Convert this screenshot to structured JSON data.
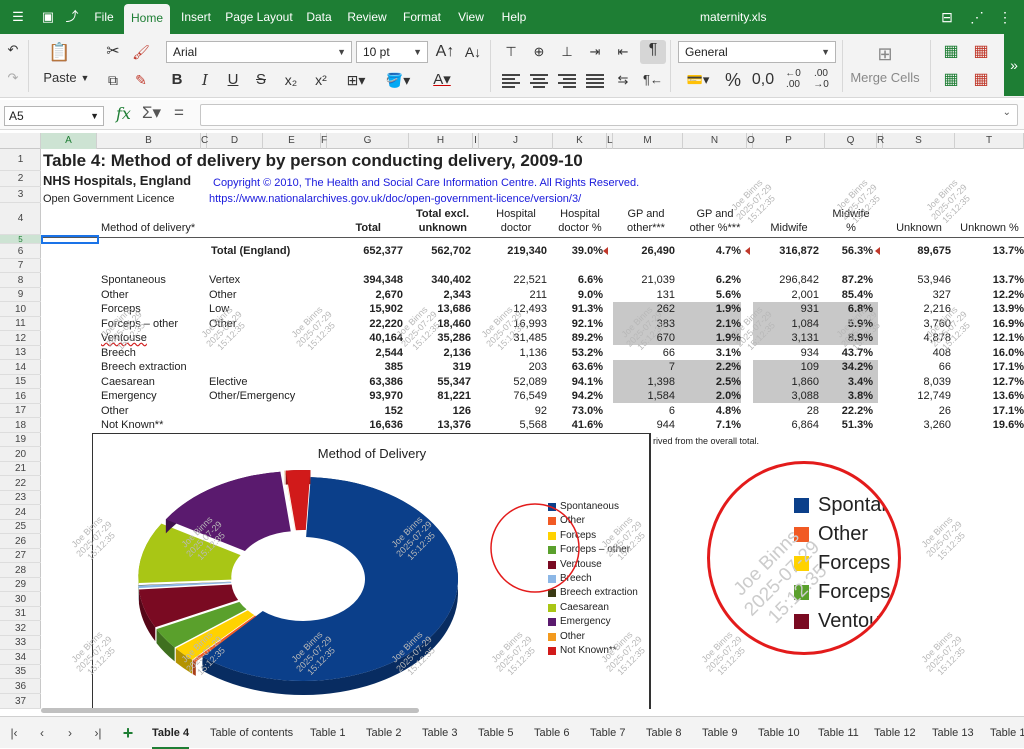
{
  "app": {
    "file_name": "maternity.xls",
    "menu_tabs": [
      "File",
      "Home",
      "Insert",
      "Page Layout",
      "Data",
      "Review",
      "Format",
      "View",
      "Help"
    ],
    "active_tab": "Home"
  },
  "ribbon": {
    "paste_label": "Paste",
    "font_name": "Arial",
    "font_size": "10 pt",
    "number_format": "General",
    "merge_cells_label": "Merge Cells"
  },
  "formula_bar": {
    "cell_ref": "A5",
    "formula": ""
  },
  "columns": [
    "A",
    "B",
    "C",
    "D",
    "E",
    "F",
    "G",
    "H",
    "I",
    "J",
    "K",
    "L",
    "M",
    "N",
    "O",
    "P",
    "Q",
    "R",
    "S",
    "T"
  ],
  "rows": [
    "1",
    "2",
    "3",
    "4",
    "5",
    "6",
    "7",
    "8",
    "9",
    "10",
    "11",
    "12",
    "13",
    "14",
    "15",
    "16",
    "17",
    "18",
    "19",
    "20",
    "21",
    "22",
    "23",
    "24",
    "25",
    "26",
    "27",
    "28",
    "29",
    "30",
    "31",
    "32",
    "33",
    "34",
    "35",
    "36",
    "37"
  ],
  "sheet": {
    "title": "Table 4: Method of delivery by person conducting delivery, 2009-10",
    "org": "NHS Hospitals, England",
    "copyright": "Copyright © 2010, The Health and Social Care Information Centre. All Rights Reserved.",
    "licence": "Open Government Licence",
    "licence_url": "https://www.nationalarchives.gov.uk/doc/open-government-licence/version/3/",
    "headers": {
      "method": "Method of delivery*",
      "total": "Total",
      "total_excl_1": "Total excl.",
      "total_excl_2": "unknown",
      "hosp_doc_1": "Hospital",
      "hosp_doc_2": "doctor",
      "hosp_pct_1": "Hospital",
      "hosp_pct_2": "doctor %",
      "gp_1": "GP and",
      "gp_2": "other***",
      "gp_pct_1": "GP and",
      "gp_pct_2": "other %***",
      "midwife": "Midwife",
      "midwife_pct_1": "Midwife",
      "midwife_pct_2": "%",
      "unknown": "Unknown",
      "unknown_pct": "Unknown %"
    },
    "total_row": {
      "label": "Total (England)",
      "total": "652,377",
      "excl": "562,702",
      "hosp": "219,340",
      "hosp_pct": "39.0%",
      "gp": "26,490",
      "gp_pct": "4.7%",
      "mid": "316,872",
      "mid_pct": "56.3%",
      "unk": "89,675",
      "unk_pct": "13.7%"
    },
    "data_rows": [
      {
        "method": "Spontaneous",
        "sub": "Vertex",
        "total": "394,348",
        "excl": "340,402",
        "hosp": "22,521",
        "hosp_pct": "6.6%",
        "gp": "21,039",
        "gp_pct": "6.2%",
        "mid": "296,842",
        "mid_pct": "87.2%",
        "unk": "53,946",
        "unk_pct": "13.7%"
      },
      {
        "method": "Other",
        "sub": "Other",
        "total": "2,670",
        "excl": "2,343",
        "hosp": "211",
        "hosp_pct": "9.0%",
        "gp": "131",
        "gp_pct": "5.6%",
        "mid": "2,001",
        "mid_pct": "85.4%",
        "unk": "327",
        "unk_pct": "12.2%"
      },
      {
        "method": "Forceps",
        "sub": "Low",
        "total": "15,902",
        "excl": "13,686",
        "hosp": "12,493",
        "hosp_pct": "91.3%",
        "gp": "262",
        "gp_pct": "1.9%",
        "mid": "931",
        "mid_pct": "6.8%",
        "unk": "2,216",
        "unk_pct": "13.9%"
      },
      {
        "method": "Forceps – other",
        "sub": "Other",
        "total": "22,220",
        "excl": "18,460",
        "hosp": "16,993",
        "hosp_pct": "92.1%",
        "gp": "383",
        "gp_pct": "2.1%",
        "mid": "1,084",
        "mid_pct": "5.9%",
        "unk": "3,760",
        "unk_pct": "16.9%"
      },
      {
        "method": "Ventouse",
        "sub": "",
        "total": "40,164",
        "excl": "35,286",
        "hosp": "31,485",
        "hosp_pct": "89.2%",
        "gp": "670",
        "gp_pct": "1.9%",
        "mid": "3,131",
        "mid_pct": "8.9%",
        "unk": "4,878",
        "unk_pct": "12.1%"
      },
      {
        "method": "Breech",
        "sub": "",
        "total": "2,544",
        "excl": "2,136",
        "hosp": "1,136",
        "hosp_pct": "53.2%",
        "gp": "66",
        "gp_pct": "3.1%",
        "mid": "934",
        "mid_pct": "43.7%",
        "unk": "408",
        "unk_pct": "16.0%"
      },
      {
        "method": "Breech extraction",
        "sub": "",
        "total": "385",
        "excl": "319",
        "hosp": "203",
        "hosp_pct": "63.6%",
        "gp": "7",
        "gp_pct": "2.2%",
        "mid": "109",
        "mid_pct": "34.2%",
        "unk": "66",
        "unk_pct": "17.1%"
      },
      {
        "method": "Caesarean",
        "sub": "Elective",
        "total": "63,386",
        "excl": "55,347",
        "hosp": "52,089",
        "hosp_pct": "94.1%",
        "gp": "1,398",
        "gp_pct": "2.5%",
        "mid": "1,860",
        "mid_pct": "3.4%",
        "unk": "8,039",
        "unk_pct": "12.7%"
      },
      {
        "method": "Emergency",
        "sub": "Other/Emergency",
        "total": "93,970",
        "excl": "81,221",
        "hosp": "76,549",
        "hosp_pct": "94.2%",
        "gp": "1,584",
        "gp_pct": "2.0%",
        "mid": "3,088",
        "mid_pct": "3.8%",
        "unk": "12,749",
        "unk_pct": "13.6%"
      },
      {
        "method": "Other",
        "sub": "",
        "total": "152",
        "excl": "126",
        "hosp": "92",
        "hosp_pct": "73.0%",
        "gp": "6",
        "gp_pct": "4.8%",
        "mid": "28",
        "mid_pct": "22.2%",
        "unk": "26",
        "unk_pct": "17.1%"
      },
      {
        "method": "Not Known**",
        "sub": "",
        "total": "16,636",
        "excl": "13,376",
        "hosp": "5,568",
        "hosp_pct": "41.6%",
        "gp": "944",
        "gp_pct": "7.1%",
        "mid": "6,864",
        "mid_pct": "51.3%",
        "unk": "3,260",
        "unk_pct": "19.6%"
      }
    ],
    "note_fragment": "rived from the overall total."
  },
  "watermark": {
    "name": "Joe Binns",
    "date": "2025-07-29",
    "time": "15:12:35"
  },
  "zoom_legend": [
    "Spontaneous",
    "Other",
    "Forceps",
    "Forceps – other",
    "Ventouse"
  ],
  "chart_data": {
    "type": "pie",
    "title": "Method of Delivery",
    "categories": [
      "Spontaneous",
      "Other",
      "Forceps",
      "Forceps – other",
      "Ventouse",
      "Breech",
      "Breech extraction",
      "Caesarean",
      "Emergency",
      "Other",
      "Not Known**"
    ],
    "values": [
      394348,
      2670,
      15902,
      22220,
      40164,
      2544,
      385,
      63386,
      93970,
      152,
      16636
    ],
    "colors": [
      "#0b3f8a",
      "#f15a24",
      "#ffd200",
      "#5aa02c",
      "#7a0a22",
      "#8cb7e6",
      "#3a3a14",
      "#a9c615",
      "#5a1a6e",
      "#f39a1e",
      "#d11a1a"
    ],
    "legend_position": "right"
  },
  "sheets": {
    "tabs": [
      "Table 4",
      "Table of contents",
      "Table 1",
      "Table 2",
      "Table 3",
      "Table 5",
      "Table 6",
      "Table 7",
      "Table 8",
      "Table 9",
      "Table 10",
      "Table 11",
      "Table 12",
      "Table 13",
      "Table 1"
    ],
    "active": "Table 4"
  }
}
